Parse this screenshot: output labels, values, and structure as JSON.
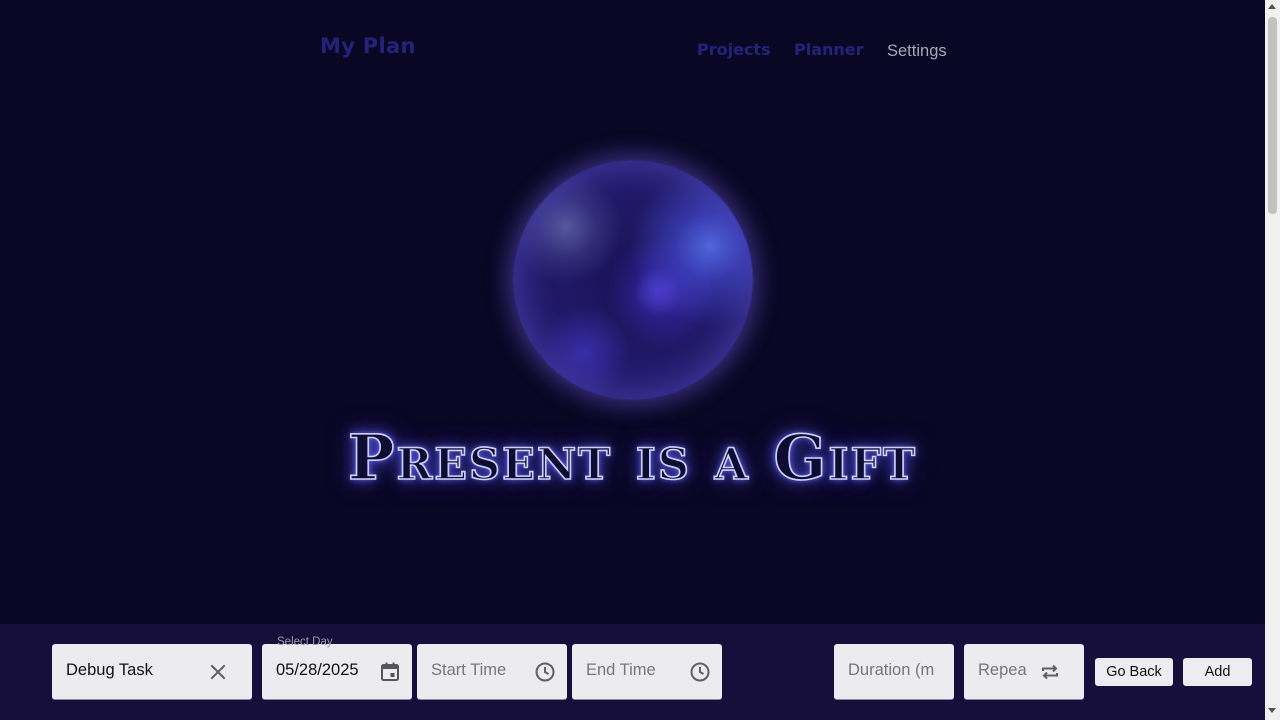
{
  "header": {
    "brand": "My Plan",
    "nav": [
      {
        "label": "Projects"
      },
      {
        "label": "Planner"
      },
      {
        "label": "Settings"
      }
    ]
  },
  "hero": {
    "headline": "Present is a Gift"
  },
  "task_form": {
    "task_name": {
      "value": "Debug Task",
      "clear_icon": "close-icon"
    },
    "select_day": {
      "label": "Select Day",
      "value": "05/28/2025",
      "icon": "calendar-icon"
    },
    "start_time": {
      "placeholder": "Start Time",
      "icon": "clock-icon"
    },
    "end_time": {
      "placeholder": "End Time",
      "icon": "clock-icon"
    },
    "duration": {
      "placeholder": "Duration (m"
    },
    "repeat": {
      "placeholder": "Repea",
      "icon": "repeat-icon"
    },
    "go_back_label": "Go Back",
    "add_label": "Add"
  },
  "colors": {
    "background": "#0a0724",
    "bottom_bar": "#160f3c",
    "nav_accent": "#23237a",
    "glow": "#5a5aff"
  }
}
